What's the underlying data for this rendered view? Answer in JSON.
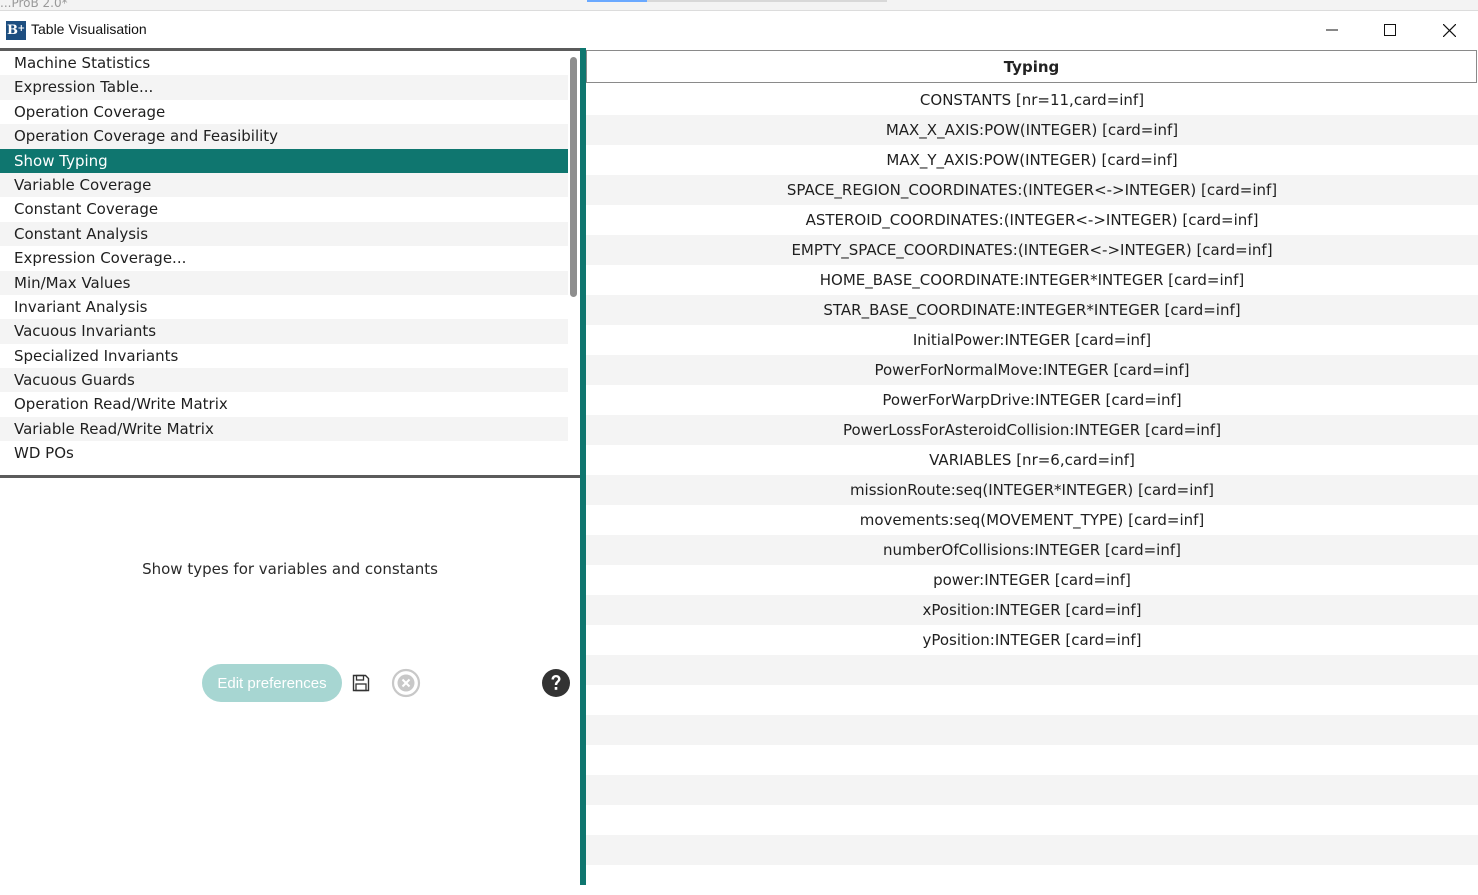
{
  "background_app": {
    "title": "...ProB 2.0*"
  },
  "window": {
    "title": "Table Visualisation",
    "icon_label": "B"
  },
  "left_list": {
    "items": [
      "Machine Statistics",
      "Expression Table...",
      "Operation Coverage",
      "Operation Coverage and Feasibility",
      "Show Typing",
      "Variable Coverage",
      "Constant Coverage",
      "Constant Analysis",
      "Expression Coverage...",
      "Min/Max Values",
      "Invariant Analysis",
      "Vacuous Invariants",
      "Specialized Invariants",
      "Vacuous Guards",
      "Operation Read/Write Matrix",
      "Variable Read/Write Matrix",
      "WD POs"
    ],
    "selected": "Show Typing"
  },
  "description": "Show types for variables and constants",
  "buttons": {
    "edit_preferences": "Edit preferences"
  },
  "table": {
    "header": "Typing",
    "rows": [
      "CONSTANTS [nr=11,card=inf]",
      "MAX_X_AXIS:POW(INTEGER) [card=inf]",
      "MAX_Y_AXIS:POW(INTEGER) [card=inf]",
      "SPACE_REGION_COORDINATES:(INTEGER<->INTEGER) [card=inf]",
      "ASTEROID_COORDINATES:(INTEGER<->INTEGER) [card=inf]",
      "EMPTY_SPACE_COORDINATES:(INTEGER<->INTEGER) [card=inf]",
      "HOME_BASE_COORDINATE:INTEGER*INTEGER [card=inf]",
      "STAR_BASE_COORDINATE:INTEGER*INTEGER [card=inf]",
      "InitialPower:INTEGER [card=inf]",
      "PowerForNormalMove:INTEGER [card=inf]",
      "PowerForWarpDrive:INTEGER [card=inf]",
      "PowerLossForAsteroidCollision:INTEGER [card=inf]",
      "VARIABLES [nr=6,card=inf]",
      "missionRoute:seq(INTEGER*INTEGER) [card=inf]",
      "movements:seq(MOVEMENT_TYPE) [card=inf]",
      "numberOfCollisions:INTEGER [card=inf]",
      "power:INTEGER [card=inf]",
      "xPosition:INTEGER [card=inf]",
      "yPosition:INTEGER [card=inf]"
    ]
  },
  "colors": {
    "accent": "#0f766f",
    "button_disabled": "#a7d6d2",
    "stripe": "#f4f4f4"
  },
  "icons": {
    "minimize": "minimize-icon",
    "maximize": "maximize-icon",
    "close": "close-icon",
    "save": "save-icon",
    "cancel": "cancel-icon",
    "help": "help-icon"
  }
}
